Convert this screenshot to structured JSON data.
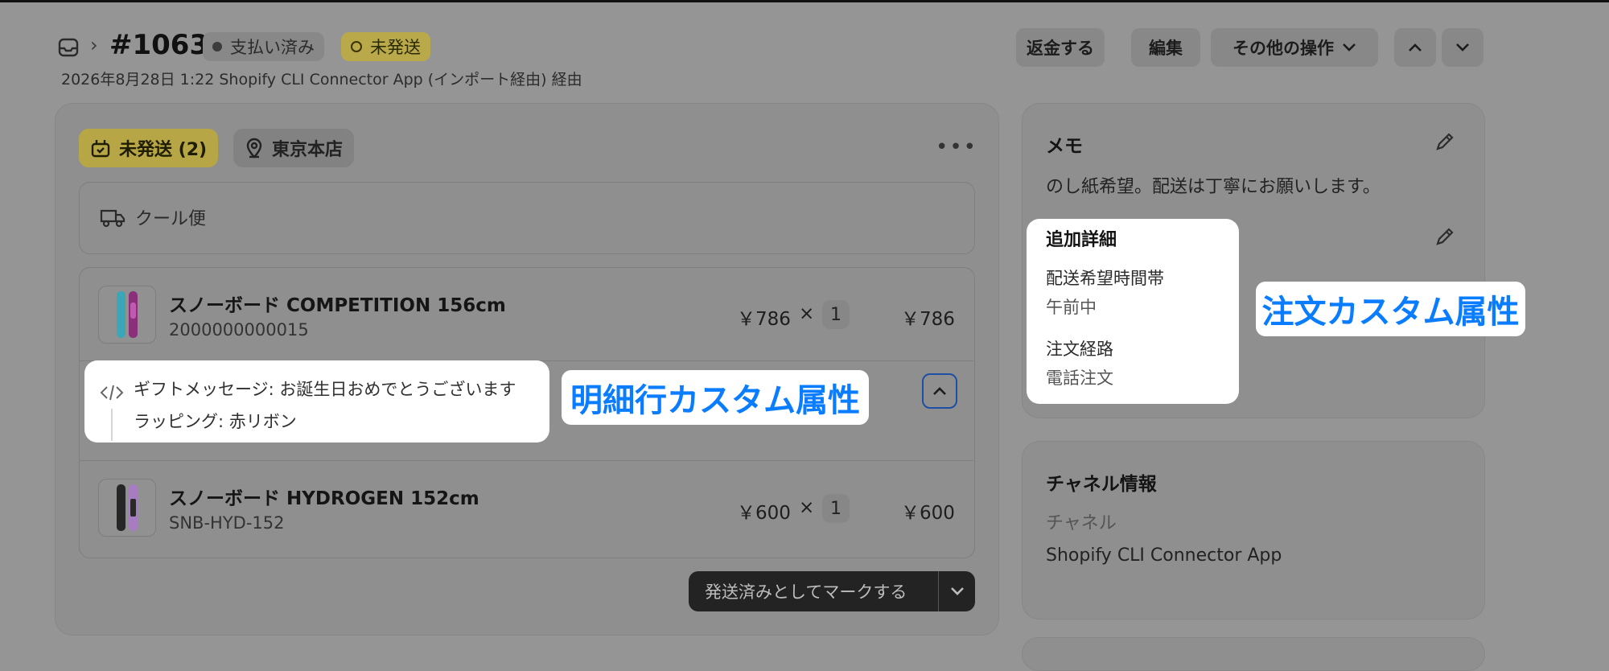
{
  "header": {
    "order_number": "#1063",
    "badge_paid": "支払い済み",
    "badge_unfulfilled": "未発送",
    "subtitle": "2026年8月28日 1:22 Shopify CLI Connector App (インポート経由) 経由",
    "btn_refund": "返金する",
    "btn_edit": "編集",
    "btn_more": "その他の操作"
  },
  "fulfillment": {
    "status_pill": "未発送 (2)",
    "location_pill": "東京本店",
    "shipping_method": "クール便",
    "items": [
      {
        "title": "スノーボード COMPETITION 156cm",
        "sku": "2000000000015",
        "unit_price": "￥786",
        "times": "×",
        "quantity": "1",
        "total": "￥786"
      },
      {
        "title": "スノーボード HYDROGEN 152cm",
        "sku": "SNB-HYD-152",
        "unit_price": "￥600",
        "times": "×",
        "quantity": "1",
        "total": "￥600"
      }
    ],
    "line_properties": [
      "ギフトメッセージ: お誕生日おめでとうございます",
      "ラッピング: 赤リボン"
    ],
    "mark_button": "発送済みとしてマークする"
  },
  "annotations": {
    "line_item_callout": "明細行カスタム属性",
    "order_callout": "注文カスタム属性",
    "callout_color": "#0a7cff"
  },
  "notes": {
    "title": "メモ",
    "text": "のし紙希望。配送は丁寧にお願いします。"
  },
  "additional_details": {
    "title": "追加詳細",
    "fields": [
      {
        "label": "配送希望時間帯",
        "value": "午前中"
      },
      {
        "label": "注文経路",
        "value": "電話注文"
      }
    ]
  },
  "channel": {
    "title": "チャネル情報",
    "label": "チャネル",
    "value": "Shopify CLI Connector App"
  }
}
